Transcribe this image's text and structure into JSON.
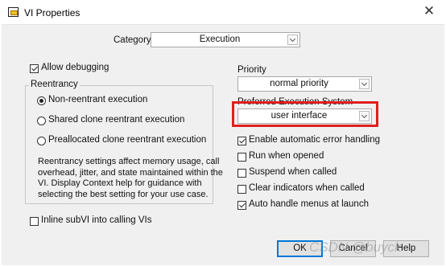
{
  "window": {
    "title": "VI Properties",
    "close_glyph": "✕"
  },
  "category": {
    "label": "Category",
    "value": "Execution"
  },
  "allow_debugging": {
    "label": "Allow debugging",
    "checked": true
  },
  "reentrancy": {
    "title": "Reentrancy",
    "options": [
      {
        "label": "Non-reentrant execution",
        "selected": true
      },
      {
        "label": "Shared clone reentrant execution",
        "selected": false
      },
      {
        "label": "Preallocated clone reentrant execution",
        "selected": false
      }
    ],
    "description_lines": [
      "Reentrancy settings affect memory usage, call",
      "overhead, jitter, and state maintained within the",
      "VI. Display Context help for guidance with",
      "selecting the best setting for your use case."
    ]
  },
  "inline_subvi": {
    "label": "Inline subVI into calling VIs",
    "checked": false
  },
  "priority": {
    "label": "Priority",
    "value": "normal priority"
  },
  "preferred_execution": {
    "label": "Preferred Execution System",
    "value": "user interface"
  },
  "options": [
    {
      "label": "Enable automatic error handling",
      "checked": true
    },
    {
      "label": "Run when opened",
      "checked": false
    },
    {
      "label": "Suspend when called",
      "checked": false
    },
    {
      "label": "Clear indicators when called",
      "checked": false
    },
    {
      "label": "Auto handle menus at launch",
      "checked": true
    }
  ],
  "buttons": {
    "ok": "OK",
    "cancel": "Cancel",
    "help": "Help"
  },
  "watermark": "CSDN @buyck",
  "colors": {
    "highlight": "#e01e1e",
    "accent": "#0078d7"
  }
}
